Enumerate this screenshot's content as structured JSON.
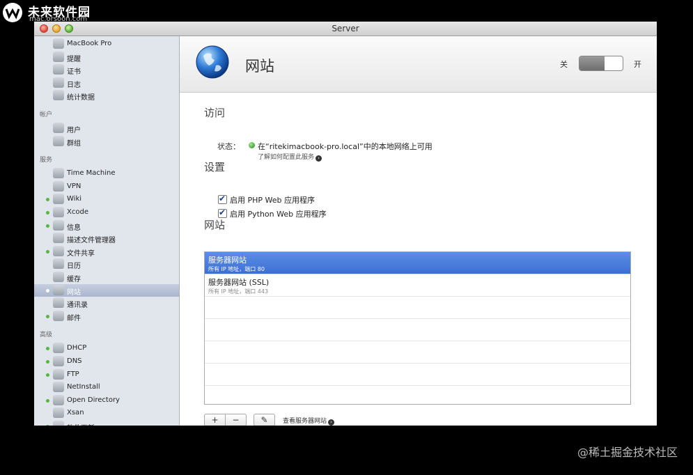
{
  "watermark": {
    "title": "未来软件园",
    "subtitle": "mac.orsoon.com",
    "corner": "@稀土掘金技术社区"
  },
  "window": {
    "title": "Server"
  },
  "sidebar": {
    "top_items": [
      {
        "label": "MacBook Pro",
        "icon": "laptop-icon",
        "active": false
      },
      {
        "label": "提醒",
        "icon": "megaphone-icon",
        "active": false
      },
      {
        "label": "证书",
        "icon": "certificate-icon",
        "active": false
      },
      {
        "label": "日志",
        "icon": "log-icon",
        "active": false
      },
      {
        "label": "统计数据",
        "icon": "stats-icon",
        "active": false
      }
    ],
    "accounts_header": "帐户",
    "accounts": [
      {
        "label": "用户",
        "icon": "user-icon",
        "active": false
      },
      {
        "label": "群组",
        "icon": "group-icon",
        "active": false
      }
    ],
    "services_header": "服务",
    "services": [
      {
        "label": "Time Machine",
        "icon": "time-machine-icon",
        "active": false
      },
      {
        "label": "VPN",
        "icon": "vpn-icon",
        "active": false
      },
      {
        "label": "Wiki",
        "icon": "wiki-icon",
        "active": true
      },
      {
        "label": "Xcode",
        "icon": "xcode-icon",
        "active": true
      },
      {
        "label": "信息",
        "icon": "messages-icon",
        "active": true
      },
      {
        "label": "描述文件管理器",
        "icon": "profile-manager-icon",
        "active": false
      },
      {
        "label": "文件共享",
        "icon": "file-sharing-icon",
        "active": true
      },
      {
        "label": "日历",
        "icon": "calendar-icon",
        "active": false
      },
      {
        "label": "缓存",
        "icon": "caching-icon",
        "active": false
      },
      {
        "label": "网站",
        "icon": "websites-icon",
        "active": true,
        "selected": true
      },
      {
        "label": "通讯录",
        "icon": "contacts-icon",
        "active": false
      },
      {
        "label": "邮件",
        "icon": "mail-icon",
        "active": true
      }
    ],
    "advanced_header": "高级",
    "advanced": [
      {
        "label": "DHCP",
        "icon": "dhcp-icon",
        "active": true
      },
      {
        "label": "DNS",
        "icon": "dns-icon",
        "active": true
      },
      {
        "label": "FTP",
        "icon": "ftp-icon",
        "active": true
      },
      {
        "label": "NetInstall",
        "icon": "netinstall-icon",
        "active": false
      },
      {
        "label": "Open Directory",
        "icon": "open-directory-icon",
        "active": true
      },
      {
        "label": "Xsan",
        "icon": "xsan-icon",
        "active": false
      },
      {
        "label": "软件更新",
        "icon": "software-update-icon",
        "active": true
      }
    ]
  },
  "main": {
    "title": "网站",
    "toggle": {
      "off_label": "关",
      "on_label": "开",
      "state": "off"
    },
    "access": {
      "header": "访问",
      "status_label": "状态：",
      "status_text": "在“ritekimacbook-pro.local”中的本地网络上可用",
      "status_color": "#3ba22f",
      "help_link": "了解如何配置此服务"
    },
    "settings": {
      "header": "设置",
      "options": [
        {
          "label": "启用 PHP Web 应用程序",
          "checked": true
        },
        {
          "label": "启用 Python Web 应用程序",
          "checked": true
        }
      ]
    },
    "websites": {
      "header": "网站",
      "rows": [
        {
          "name": "服务器网站",
          "detail": "所有 IP 地址，端口 80",
          "selected": true
        },
        {
          "name": "服务器网站 (SSL)",
          "detail": "所有 IP 地址，端口 443",
          "selected": false
        }
      ],
      "add_label": "+",
      "remove_label": "−",
      "edit_label": "✎",
      "view_link": "查看服务器网站"
    }
  }
}
